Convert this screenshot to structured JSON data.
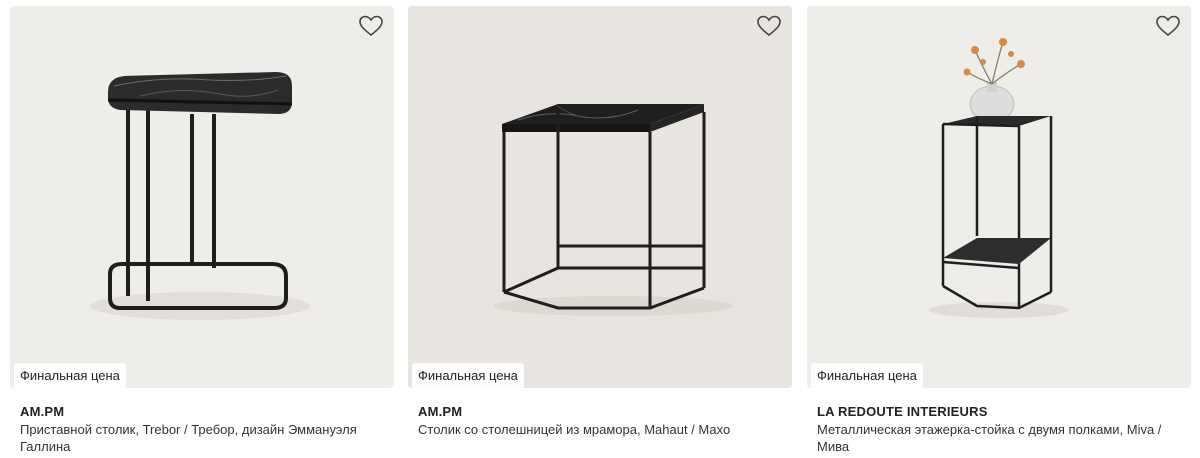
{
  "products": [
    {
      "brand": "AM.PM",
      "title": "Приставной столик, Trebor / Требор, дизайн Эммануэля Галлина",
      "price_label": "Финальная цена",
      "favorite_icon": "heart-outline-icon",
      "image_bg": "#efedea"
    },
    {
      "brand": "AM.PM",
      "title": "Столик со столешницей из мрамора, Mahaut / Махо",
      "price_label": "Финальная цена",
      "favorite_icon": "heart-outline-icon",
      "image_bg": "#e8e4df"
    },
    {
      "brand": "LA REDOUTE INTERIEURS",
      "title": "Металлическая этажерка-стойка с двумя полками, Miva / Мива",
      "price_label": "Финальная цена",
      "favorite_icon": "heart-outline-icon",
      "image_bg": "#efedea"
    }
  ]
}
